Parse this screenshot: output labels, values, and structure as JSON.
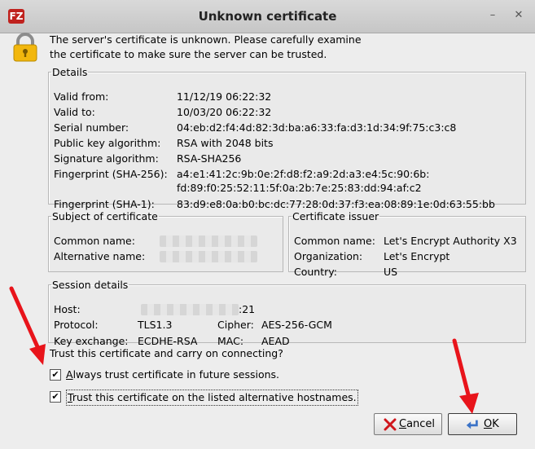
{
  "window": {
    "title": "Unknown certificate",
    "app_icon_text": "FZ",
    "minimize_glyph": "–",
    "close_glyph": "✕"
  },
  "intro": {
    "line1": "The server's certificate is unknown. Please carefully examine",
    "line2": "the certificate to make sure the server can be trusted.",
    "icon": "lock-icon"
  },
  "details": {
    "legend": "Details",
    "valid_from_label": "Valid from:",
    "valid_from": "11/12/19 06:22:32",
    "valid_to_label": "Valid to:",
    "valid_to": "10/03/20 06:22:32",
    "serial_label": "Serial number:",
    "serial": "04:eb:d2:f4:4d:82:3d:ba:a6:33:fa:d3:1d:34:9f:75:c3:c8",
    "pubkey_label": "Public key algorithm:",
    "pubkey": "RSA with 2048 bits",
    "sigalg_label": "Signature algorithm:",
    "sigalg": "RSA-SHA256",
    "fp256_label": "Fingerprint (SHA-256):",
    "fp256_line1": "a4:e1:41:2c:9b:0e:2f:d8:f2:a9:2d:a3:e4:5c:90:6b:",
    "fp256_line2": "fd:89:f0:25:52:11:5f:0a:2b:7e:25:83:dd:94:af:c2",
    "fp1_label": "Fingerprint (SHA-1):",
    "fp1": "83:d9:e8:0a:b0:bc:dc:77:28:0d:37:f3:ea:08:89:1e:0d:63:55:bb"
  },
  "subject": {
    "legend": "Subject of certificate",
    "common_name_label": "Common name:",
    "alt_name_label": "Alternative name:"
  },
  "issuer": {
    "legend": "Certificate issuer",
    "common_name_label": "Common name:",
    "common_name": "Let's Encrypt Authority X3",
    "org_label": "Organization:",
    "org": "Let's Encrypt",
    "country_label": "Country:",
    "country": "US"
  },
  "session": {
    "legend": "Session details",
    "host_label": "Host:",
    "host_suffix": ":21",
    "protocol_label": "Protocol:",
    "protocol": "TLS1.3",
    "cipher_label": "Cipher:",
    "cipher": "AES-256-GCM",
    "kex_label": "Key exchange:",
    "kex": "ECDHE-RSA",
    "mac_label": "MAC:",
    "mac": "AEAD"
  },
  "trust": {
    "prompt": "Trust this certificate and carry on connecting?",
    "always_first": "A",
    "always_rest": "lways trust certificate in future sessions.",
    "always_checked": true,
    "alt_first": "T",
    "alt_rest": "rust this certificate on the listed alternative hostnames.",
    "alt_checked": true,
    "check_glyph": "✔"
  },
  "buttons": {
    "cancel_first": "C",
    "cancel_rest": "ancel",
    "ok_first": "O",
    "ok_rest": "K"
  },
  "colors": {
    "annotation_arrow": "#e8141b"
  }
}
